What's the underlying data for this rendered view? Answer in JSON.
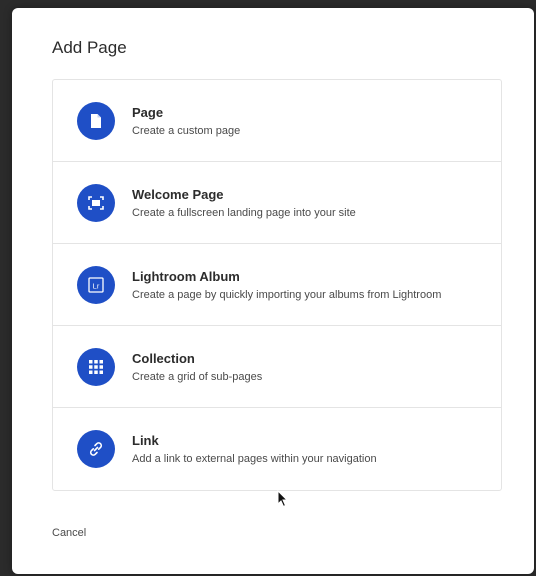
{
  "dialog": {
    "title": "Add Page",
    "cancel_label": "Cancel"
  },
  "options": [
    {
      "name": "Page",
      "description": "Create a custom page",
      "icon": "page-icon"
    },
    {
      "name": "Welcome Page",
      "description": "Create a fullscreen landing page into your site",
      "icon": "welcome-page-icon"
    },
    {
      "name": "Lightroom Album",
      "description": "Create a page by quickly importing your albums from Lightroom",
      "icon": "lightroom-icon",
      "icon_text": "Lr"
    },
    {
      "name": "Collection",
      "description": "Create a grid of sub-pages",
      "icon": "grid-icon"
    },
    {
      "name": "Link",
      "description": "Add a link to external pages within your navigation",
      "icon": "link-icon"
    }
  ],
  "colors": {
    "accent": "#1f4fc6",
    "border": "#e4e4e4",
    "text": "#2c2c2c"
  }
}
